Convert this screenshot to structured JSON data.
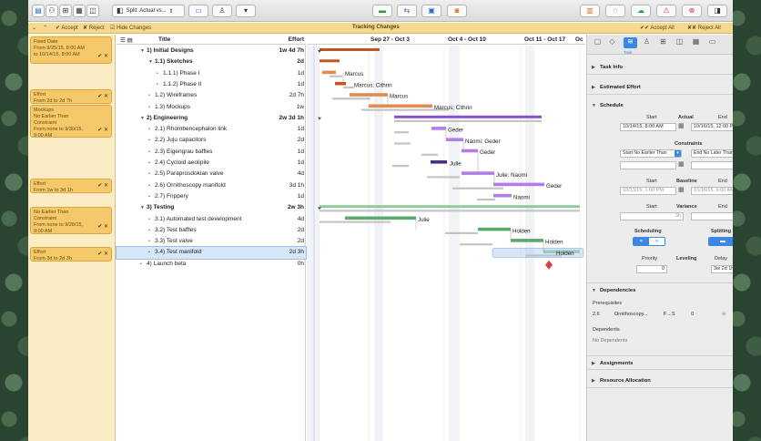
{
  "toolbar": {
    "split_label": "Split: Actual vs..."
  },
  "tracking": {
    "accept_label": "Accept",
    "reject_label": "Reject",
    "hide_changes_label": "Hide Changes",
    "title": "Tracking Changes",
    "accept_all_label": "Accept All",
    "reject_all_label": "Reject All"
  },
  "changes": [
    {
      "lines": [
        "Fixed Date",
        "From 9/25/15, 8:00 AM",
        "to 10/14/15, 8:00 AM"
      ]
    },
    {
      "lines": [
        "Effort",
        "From 2d to 2d 7h"
      ]
    },
    {
      "lines": [
        "Mockups",
        "No Earlier Than",
        "Constraint",
        "From none to 9/30/15,",
        "9:00 AM"
      ]
    },
    {
      "lines": [
        "Effort",
        "From 1w to 3d 1h"
      ]
    },
    {
      "lines": [
        "No Earlier Than",
        "Constraint",
        "From none to 9/28/15,",
        "9:00 AM"
      ]
    },
    {
      "lines": [
        "Effort",
        "From 3d to 2d 3h"
      ]
    }
  ],
  "outline": {
    "title_header": "Title",
    "effort_header": "Effort",
    "rows": [
      {
        "num": "1)",
        "title": "Initial Designs",
        "effort": "1w 4d 7h",
        "level": 0,
        "group": true
      },
      {
        "num": "1.1)",
        "title": "Sketches",
        "effort": "2d",
        "level": 1,
        "group": true
      },
      {
        "num": "1.1.1)",
        "title": "Phase I",
        "effort": "1d",
        "level": 2,
        "group": false
      },
      {
        "num": "1.1.2)",
        "title": "Phase II",
        "effort": "1d",
        "level": 2,
        "group": false
      },
      {
        "num": "1.2)",
        "title": "Wireframes",
        "effort": "2d 7h",
        "level": 1,
        "group": false
      },
      {
        "num": "1.3)",
        "title": "Mockups",
        "effort": "1w",
        "level": 1,
        "group": false
      },
      {
        "num": "2)",
        "title": "Engineering",
        "effort": "2w 3d 1h",
        "level": 0,
        "group": true
      },
      {
        "num": "2.1)",
        "title": "Rhombencephalon link",
        "effort": "1d",
        "level": 1,
        "group": false
      },
      {
        "num": "2.2)",
        "title": "Juju capacitors",
        "effort": "2d",
        "level": 1,
        "group": false
      },
      {
        "num": "2.3)",
        "title": "Eigengrau baffles",
        "effort": "1d",
        "level": 1,
        "group": false
      },
      {
        "num": "2.4)",
        "title": "Cycloid aeolipile",
        "effort": "1d",
        "level": 1,
        "group": false
      },
      {
        "num": "2.5)",
        "title": "Paraprosdokian valve",
        "effort": "4d",
        "level": 1,
        "group": false
      },
      {
        "num": "2.6)",
        "title": "Ornithoscopy manifold",
        "effort": "3d 1h",
        "level": 1,
        "group": false
      },
      {
        "num": "2.7)",
        "title": "Frippery",
        "effort": "1d",
        "level": 1,
        "group": false
      },
      {
        "num": "3)",
        "title": "Testing",
        "effort": "2w 3h",
        "level": 0,
        "group": true
      },
      {
        "num": "3.1)",
        "title": "Automated test development",
        "effort": "4d",
        "level": 1,
        "group": false
      },
      {
        "num": "3.2)",
        "title": "Test baffles",
        "effort": "2d",
        "level": 1,
        "group": false
      },
      {
        "num": "3.3)",
        "title": "Test valve",
        "effort": "2d",
        "level": 1,
        "group": false
      },
      {
        "num": "3.4)",
        "title": "Test manifold",
        "effort": "2d 3h",
        "level": 1,
        "group": false,
        "selected": true
      },
      {
        "num": "4)",
        "title": "Launch beta",
        "effort": "0h",
        "level": 0,
        "group": false
      }
    ]
  },
  "gantt": {
    "weeks": [
      "Sep 27 - Oct 3",
      "Oct 4 - Oct 10",
      "Oct 11 - Oct 17",
      "Oc"
    ],
    "labels": [
      {
        "row": 2,
        "text": "Marcus"
      },
      {
        "row": 3,
        "text": "Marcus; Cithrin"
      },
      {
        "row": 4,
        "text": "Marcus"
      },
      {
        "row": 5,
        "text": "Marcus; Cithrin"
      },
      {
        "row": 7,
        "text": "Geder"
      },
      {
        "row": 8,
        "text": "Naomi; Geder"
      },
      {
        "row": 9,
        "text": "Geder"
      },
      {
        "row": 10,
        "text": "Julie"
      },
      {
        "row": 11,
        "text": "Julie; Naomi"
      },
      {
        "row": 12,
        "text": "Geder"
      },
      {
        "row": 13,
        "text": "Naomi"
      },
      {
        "row": 15,
        "text": "Julie"
      },
      {
        "row": 16,
        "text": "Holden"
      },
      {
        "row": 17,
        "text": "Holden"
      },
      {
        "row": 18,
        "text": "Holden"
      }
    ]
  },
  "inspector": {
    "tabs_label": "Task",
    "task_info": "Task Info",
    "estimated_effort": "Estimated Effort",
    "schedule": "Schedule",
    "start_label": "Start",
    "actual_label": "Actual",
    "end_label": "End",
    "actual_start": "10/14/15, 8:00 AM",
    "actual_end": "10/16/15, 12:00 PM",
    "constraints_label": "Constraints",
    "constraint_start": "Start No Earlier Than",
    "constraint_end": "End No Later Than",
    "baseline_label": "Baseline",
    "baseline_start": "10/13/15, 1:00 PM",
    "baseline_end": "10/16/15, 9:00 AM",
    "variance_label": "Variance",
    "variance_start": "3h",
    "variance_end": "0h",
    "scheduling_label": "Scheduling",
    "splitting_label": "Splitting",
    "priority_label": "Priority",
    "priority_value": "0",
    "leveling_label": "Leveling",
    "delay_label": "Delay",
    "delay_value": "3w 2d 1h",
    "dependencies": "Dependencies",
    "prerequisites_label": "Prerequisites",
    "prereq_id": "2.6",
    "prereq_name": "Ornithoscopy...",
    "prereq_type": "F→S",
    "prereq_lag": "0",
    "dependents_label": "Dependents",
    "no_dependents": "No Dependents",
    "assignments": "Assignments",
    "resource_allocation": "Resource Allocation"
  }
}
